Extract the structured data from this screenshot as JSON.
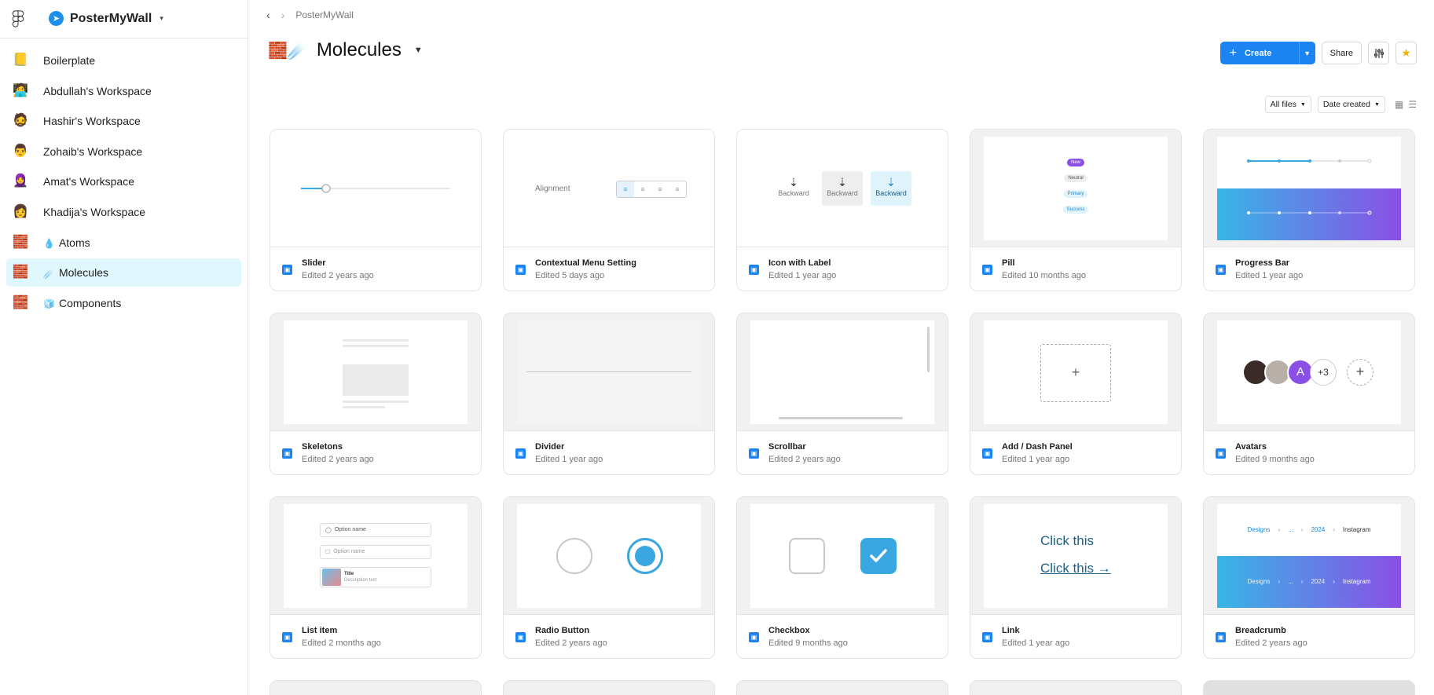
{
  "sidebar": {
    "team_name": "PosterMyWall",
    "items": [
      {
        "emoji": "📒",
        "label": "Boilerplate"
      },
      {
        "emoji": "🧑‍💻",
        "label": "Abdullah's Workspace"
      },
      {
        "emoji": "🧔",
        "label": "Hashir's Workspace"
      },
      {
        "emoji": "👨",
        "label": "Zohaib's Workspace"
      },
      {
        "emoji": "🧕",
        "label": "Amat's Workspace"
      },
      {
        "emoji": "👩",
        "label": "Khadija's Workspace"
      },
      {
        "emoji": "🧱",
        "sub": "💧",
        "label": "Atoms"
      },
      {
        "emoji": "🧱",
        "sub": "☄️",
        "label": "Molecules"
      },
      {
        "emoji": "🧱",
        "sub": "🧊",
        "label": "Components"
      }
    ]
  },
  "breadcrumb": {
    "current": "PosterMyWall"
  },
  "page": {
    "emoji": "🧱☄️",
    "title": "Molecules"
  },
  "actions": {
    "create": "Create",
    "share": "Share"
  },
  "filters": {
    "files": "All files",
    "sort": "Date created"
  },
  "cards": [
    {
      "name": "Slider",
      "edited": "Edited 2 years ago"
    },
    {
      "name": "Contextual Menu Setting",
      "edited": "Edited 5 days ago",
      "preview_label": "Alignment"
    },
    {
      "name": "Icon with Label",
      "edited": "Edited 1 year ago",
      "preview_labels": [
        "Backward",
        "Backward",
        "Backward"
      ]
    },
    {
      "name": "Pill",
      "edited": "Edited 10 months ago",
      "preview_labels": [
        "New",
        "Neutral",
        "Primary",
        "Success"
      ]
    },
    {
      "name": "Progress Bar",
      "edited": "Edited 1 year ago"
    },
    {
      "name": "Skeletons",
      "edited": "Edited 2 years ago"
    },
    {
      "name": "Divider",
      "edited": "Edited 1 year ago"
    },
    {
      "name": "Scrollbar",
      "edited": "Edited 2 years ago"
    },
    {
      "name": "Add / Dash Panel",
      "edited": "Edited 1 year ago"
    },
    {
      "name": "Avatars",
      "edited": "Edited 9 months ago",
      "preview_labels": [
        "A",
        "+3"
      ]
    },
    {
      "name": "List item",
      "edited": "Edited 2 months ago",
      "preview_labels": [
        "Option name",
        "Option name",
        "Title",
        "Description text"
      ]
    },
    {
      "name": "Radio Button",
      "edited": "Edited 2 years ago"
    },
    {
      "name": "Checkbox",
      "edited": "Edited 9 months ago"
    },
    {
      "name": "Link",
      "edited": "Edited 1 year ago",
      "preview_labels": [
        "Click this",
        "Click this"
      ]
    },
    {
      "name": "Breadcrumb",
      "edited": "Edited 2 years ago",
      "preview_labels": [
        "Designs",
        "...",
        "2024",
        "Instagram"
      ]
    }
  ],
  "colors": {
    "accent": "#1b84f0",
    "active_bg": "#e0f7fd",
    "radio": "#3aa7e0",
    "progress_start": "#37b6e6",
    "progress_end": "#8a4fe6"
  }
}
